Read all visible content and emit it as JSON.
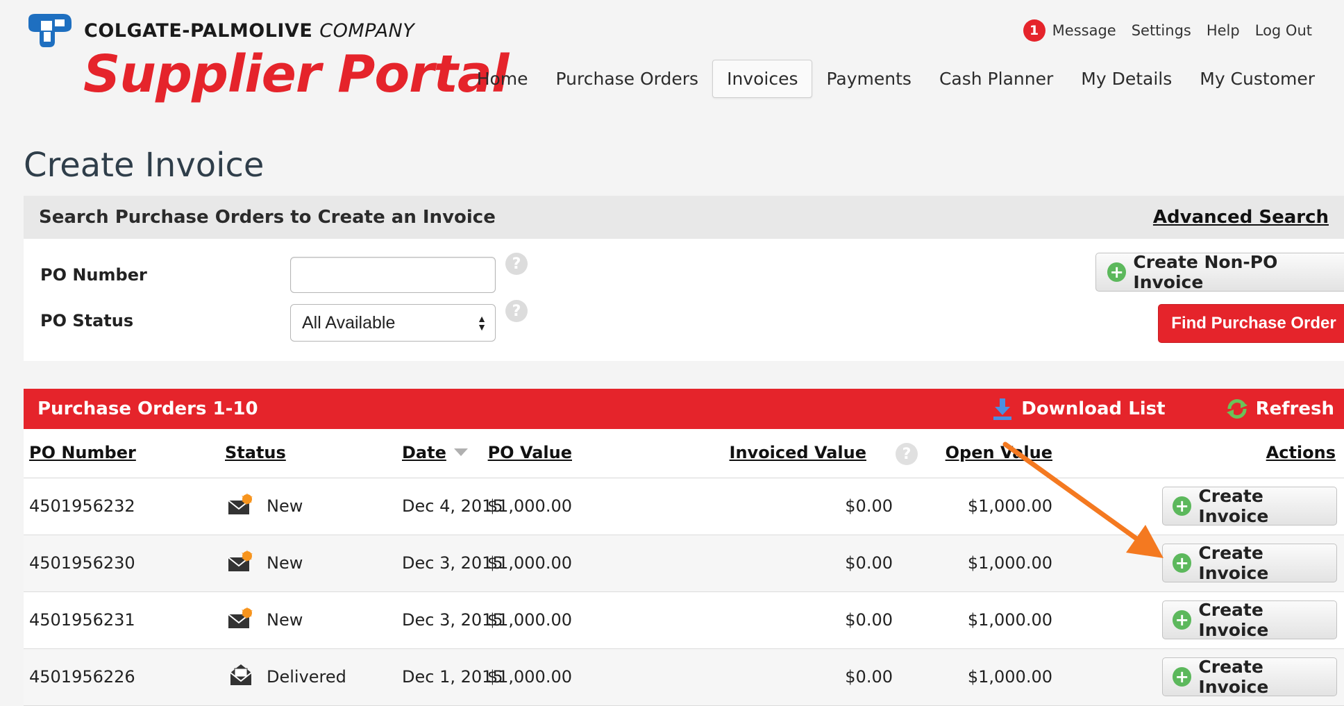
{
  "header": {
    "company_bold": "COLGATE-PALMOLIVE",
    "company_italic": "COMPANY",
    "portal_title": "Supplier Portal",
    "message_count": "1",
    "util_nav": [
      "Message",
      "Settings",
      "Help",
      "Log Out"
    ],
    "main_nav": [
      "Home",
      "Purchase Orders",
      "Invoices",
      "Payments",
      "Cash Planner",
      "My Details",
      "My Customer"
    ],
    "active_tab": "Invoices"
  },
  "page": {
    "title": "Create Invoice"
  },
  "search": {
    "title": "Search Purchase Orders to Create an Invoice",
    "advanced_link": "Advanced Search",
    "po_number_label": "PO Number",
    "po_number_value": "",
    "po_status_label": "PO Status",
    "po_status_value": "All Available",
    "help_glyph": "?",
    "non_po_button": "Create Non-PO Invoice",
    "find_button": "Find Purchase Order"
  },
  "results": {
    "title": "Purchase Orders 1-10",
    "download": "Download List",
    "refresh": "Refresh",
    "columns": {
      "po_number": "PO Number",
      "status": "Status",
      "date": "Date",
      "po_value": "PO Value",
      "invoiced_value": "Invoiced Value",
      "open_value": "Open Value",
      "actions": "Actions"
    },
    "rows": [
      {
        "po_number": "4501956232",
        "status": "New",
        "status_icon": "new-mail-icon",
        "date": "Dec 4, 2015",
        "po_value": "$1,000.00",
        "invoiced_value": "$0.00",
        "open_value": "$1,000.00",
        "action": "Create Invoice"
      },
      {
        "po_number": "4501956230",
        "status": "New",
        "status_icon": "new-mail-icon",
        "date": "Dec 3, 2015",
        "po_value": "$1,000.00",
        "invoiced_value": "$0.00",
        "open_value": "$1,000.00",
        "action": "Create Invoice"
      },
      {
        "po_number": "4501956231",
        "status": "New",
        "status_icon": "new-mail-icon",
        "date": "Dec 3, 2015",
        "po_value": "$1,000.00",
        "invoiced_value": "$0.00",
        "open_value": "$1,000.00",
        "action": "Create Invoice"
      },
      {
        "po_number": "4501956226",
        "status": "Delivered",
        "status_icon": "open-mail-icon",
        "date": "Dec 1, 2015",
        "po_value": "$1,000.00",
        "invoiced_value": "$0.00",
        "open_value": "$1,000.00",
        "action": "Create Invoice"
      }
    ]
  },
  "colors": {
    "brand_red": "#e5242b",
    "brand_blue": "#1e6fc0",
    "accent_orange": "#f47920",
    "plus_green": "#5cb85c"
  }
}
